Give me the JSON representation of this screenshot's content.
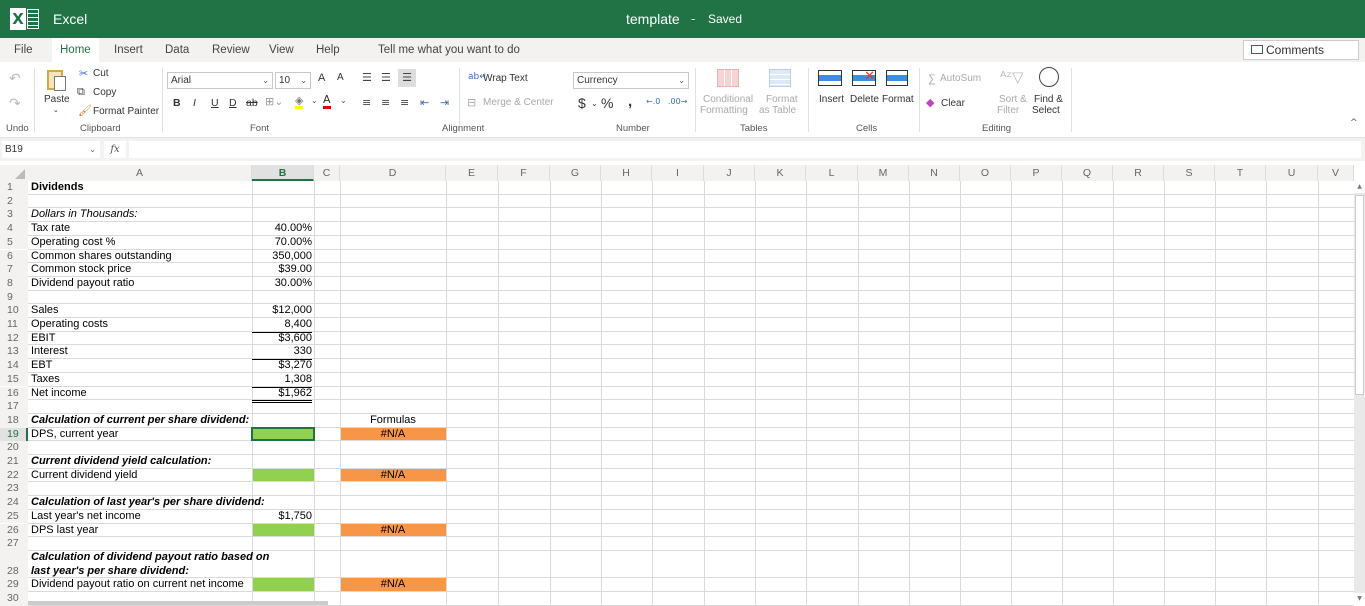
{
  "titlebar": {
    "app_name": "Excel",
    "doc_title": "template",
    "separator": "-",
    "status": "Saved"
  },
  "tabs": [
    {
      "label": "File"
    },
    {
      "label": "Home",
      "active": true
    },
    {
      "label": "Insert"
    },
    {
      "label": "Data"
    },
    {
      "label": "Review"
    },
    {
      "label": "View"
    },
    {
      "label": "Help"
    },
    {
      "label": "Tell me what you want to do"
    }
  ],
  "comments_label": "Comments",
  "ribbon": {
    "undo": {
      "group": "Undo"
    },
    "clipboard": {
      "group": "Clipboard",
      "paste": "Paste",
      "cut": "Cut",
      "copy": "Copy",
      "format_painter": "Format Painter"
    },
    "font": {
      "group": "Font",
      "family": "Arial",
      "size": "10",
      "bold": "B",
      "italic": "I",
      "underline": "U",
      "double_underline": "D",
      "strike": "ab",
      "grow": "A",
      "shrink": "A"
    },
    "alignment": {
      "group": "Alignment",
      "wrap_text": "Wrap Text",
      "merge_center": "Merge & Center"
    },
    "number": {
      "group": "Number",
      "format": "Currency",
      "currency": "$",
      "percent": "%",
      "comma": ","
    },
    "tables": {
      "group": "Tables",
      "conditional": "Conditional",
      "conditional2": "Formatting",
      "format_table": "Format",
      "format_table2": "as Table"
    },
    "cells": {
      "group": "Cells",
      "insert": "Insert",
      "delete": "Delete",
      "format": "Format"
    },
    "editing": {
      "group": "Editing",
      "autosum": "AutoSum",
      "clear": "Clear",
      "sort": "Sort &",
      "sort2": "Filter",
      "find": "Find &",
      "find2": "Select"
    }
  },
  "formula_bar": {
    "name_box": "B19",
    "fx": "fx",
    "formula": ""
  },
  "columns": [
    "A",
    "B",
    "C",
    "D",
    "E",
    "F",
    "G",
    "H",
    "I",
    "J",
    "K",
    "L",
    "M",
    "N",
    "O",
    "P",
    "Q",
    "R",
    "S",
    "T",
    "U",
    "V"
  ],
  "active_column": "B",
  "active_row": 19,
  "rows": [
    {
      "n": 1,
      "a": "Dividends",
      "a_style": "bold"
    },
    {
      "n": 2
    },
    {
      "n": 3,
      "a": "Dollars in Thousands:",
      "a_style": "it"
    },
    {
      "n": 4,
      "a": "Tax rate",
      "b": "40.00%"
    },
    {
      "n": 5,
      "a": "Operating cost %",
      "b": "70.00%"
    },
    {
      "n": 6,
      "a": "Common shares outstanding",
      "b": "350,000"
    },
    {
      "n": 7,
      "a": "Common stock price",
      "b": "$39.00"
    },
    {
      "n": 8,
      "a": "Dividend payout ratio",
      "b": "30.00%"
    },
    {
      "n": 9
    },
    {
      "n": 10,
      "a": "Sales",
      "b": "$12,000"
    },
    {
      "n": 11,
      "a": "Operating costs",
      "b": "8,400"
    },
    {
      "n": 12,
      "a": "EBIT",
      "b": "$3,600"
    },
    {
      "n": 13,
      "a": "Interest",
      "b": "330"
    },
    {
      "n": 14,
      "a": "EBT",
      "b": "$3,270"
    },
    {
      "n": 15,
      "a": "Taxes",
      "b": "1,308"
    },
    {
      "n": 16,
      "a": "Net income",
      "b": "$1,962"
    },
    {
      "n": 17
    },
    {
      "n": 18,
      "a": "Calculation of current per share dividend:",
      "a_style": "bi",
      "d": "Formulas"
    },
    {
      "n": 19,
      "a": "DPS, current year",
      "b_fill": "green",
      "d": "#N/A",
      "d_fill": "orange"
    },
    {
      "n": 20
    },
    {
      "n": 21,
      "a": "Current dividend yield calculation:",
      "a_style": "bi"
    },
    {
      "n": 22,
      "a": "Current dividend yield",
      "b_fill": "green",
      "d": "#N/A",
      "d_fill": "orange"
    },
    {
      "n": 23
    },
    {
      "n": 24,
      "a": "Calculation of last year's per share dividend:",
      "a_style": "bi"
    },
    {
      "n": 25,
      "a": "Last year's net income",
      "b": "$1,750"
    },
    {
      "n": 26,
      "a": "DPS last year",
      "b_fill": "green",
      "d": "#N/A",
      "d_fill": "orange"
    },
    {
      "n": 27
    },
    {
      "n": 28,
      "a": "Calculation of dividend payout ratio based on",
      "a2": "last year's per share dividend:",
      "a_style": "bi"
    },
    {
      "n": 29,
      "a": "Dividend payout ratio on current net income",
      "b_fill": "green",
      "d": "#N/A",
      "d_fill": "orange"
    },
    {
      "n": 30
    }
  ],
  "colors": {
    "brand": "#217346",
    "input_fill": "#92d050",
    "formula_fill": "#f79646"
  }
}
